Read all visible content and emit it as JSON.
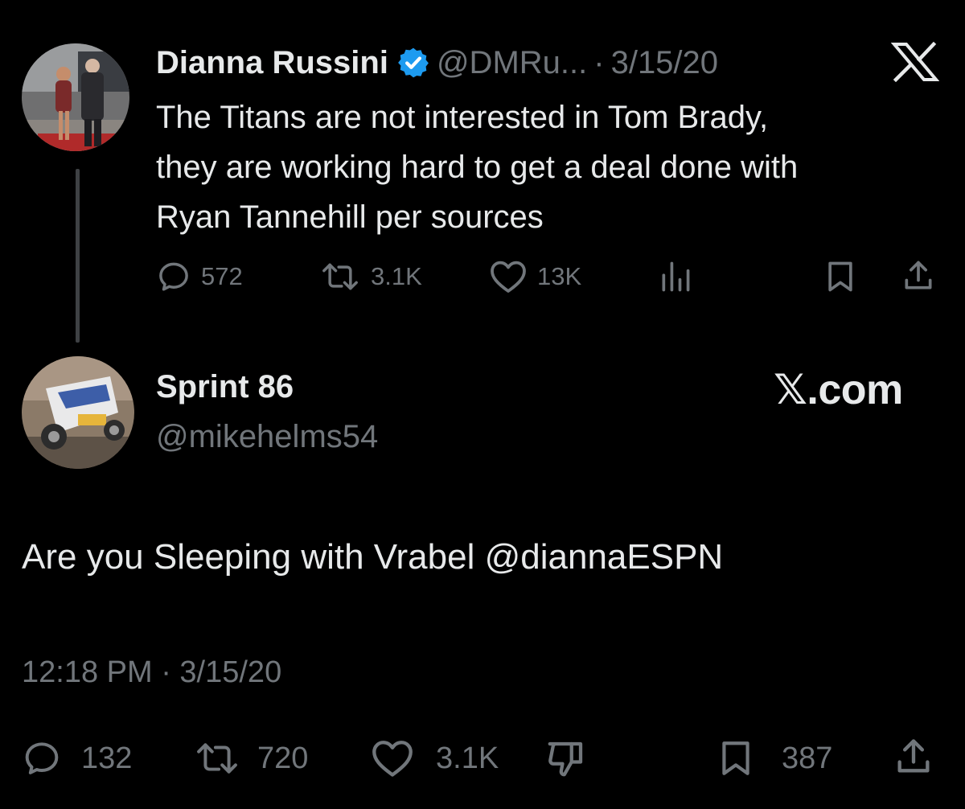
{
  "quoted_tweet": {
    "author_name": "Dianna Russini",
    "handle": "@DMRu...",
    "separator": "·",
    "date": "3/15/20",
    "text": "The Titans are not interested in Tom Brady,\nthey are working hard to get a deal done with\nRyan Tannehill per sources",
    "actions": {
      "replies": "572",
      "reposts": "3.1K",
      "likes": "13K"
    },
    "icons": [
      "verified-badge-icon",
      "x-logo-icon",
      "reply-icon",
      "repost-icon",
      "like-icon",
      "analytics-icon",
      "bookmark-icon",
      "share-icon"
    ]
  },
  "reply_tweet": {
    "author_name": "Sprint 86",
    "handle": "@mikehelms54",
    "watermark": "𝕏.com",
    "text": "Are you Sleeping with Vrabel @diannaESPN",
    "timestamp": "12:18 PM · 3/15/20",
    "actions": {
      "replies": "132",
      "reposts": "720",
      "likes": "3.1K",
      "bookmarks": "387"
    },
    "icons": [
      "reply-icon",
      "repost-icon",
      "like-icon",
      "dislike-icon",
      "bookmark-icon",
      "share-icon"
    ]
  },
  "colors": {
    "background": "#000000",
    "primary_text": "#e7e9ea",
    "secondary_text": "#71767b",
    "verified_blue": "#1d9bf0",
    "thread_line": "#3e4144"
  }
}
